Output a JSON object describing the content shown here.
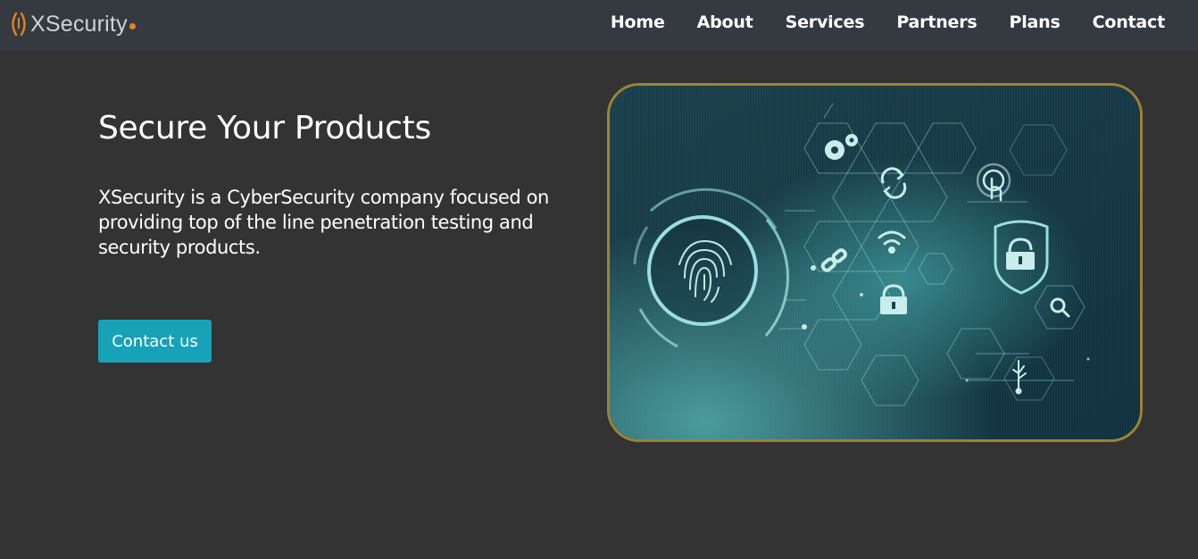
{
  "brand": {
    "name": "XSecurity",
    "accent_color": "#e8801e",
    "text_color": "#d0d3d6"
  },
  "nav": {
    "items": [
      {
        "label": "Home"
      },
      {
        "label": "About"
      },
      {
        "label": "Services"
      },
      {
        "label": "Partners"
      },
      {
        "label": "Plans"
      },
      {
        "label": "Contact"
      }
    ]
  },
  "hero": {
    "title": "Secure Your Products",
    "description": "XSecurity is a CyberSecurity company focused on providing top of the line penetration testing and security products.",
    "cta_label": "Contact us",
    "cta_color": "#17a2b8",
    "image": {
      "icons": [
        "fingerprint-icon",
        "gears-icon",
        "sync-icon",
        "touch-icon",
        "wifi-icon",
        "link-icon",
        "lock-icon",
        "unlocked-shield-icon",
        "magnifier-icon",
        "usb-icon"
      ],
      "frame_color": "#a0822f"
    }
  },
  "colors": {
    "background": "#333333",
    "navbar": "#343a40"
  }
}
